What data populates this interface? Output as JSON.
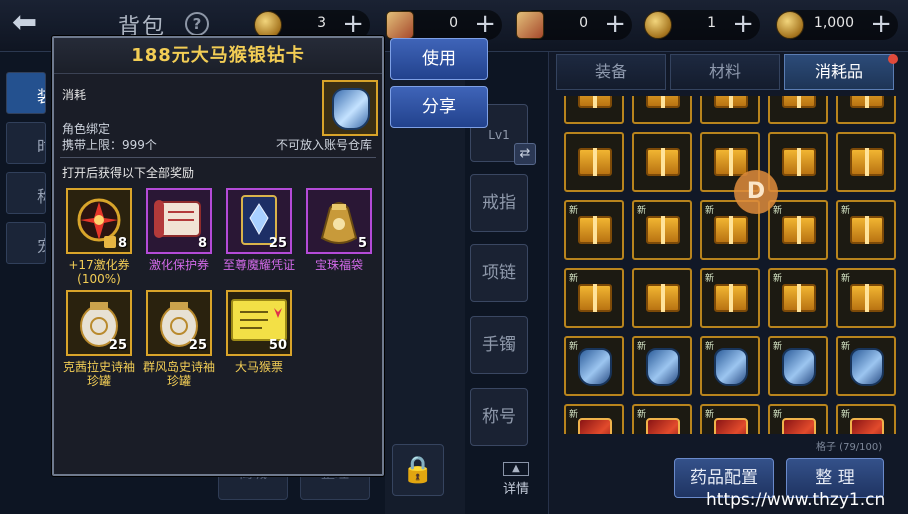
{
  "top_bar": {
    "title": "背包",
    "help_icon": "?",
    "back_icon": "back-arrow-icon",
    "currencies": [
      {
        "icon": "gold-coin-icon",
        "amount": "3"
      },
      {
        "icon": "scroll-icon",
        "amount": "0"
      },
      {
        "icon": "ticket-icon",
        "amount": "0"
      },
      {
        "icon": "gold-coin-icon",
        "amount": "1"
      },
      {
        "icon": "gold-coin-icon",
        "amount": "1,000"
      }
    ],
    "plus_label": "+"
  },
  "popup": {
    "title": "188元大马猴银钻卡",
    "category": "消耗",
    "binding": "角色绑定",
    "carry_limit": "携带上限：999个",
    "storage_note": "不可放入账号仓库",
    "rewards_header": "打开后获得以下全部奖励",
    "rewards": [
      {
        "name": "+17激化券(100%)",
        "count": "8",
        "rarity": "gold",
        "icon": "enhance-ticket-icon",
        "locked": true
      },
      {
        "name": "激化保护券",
        "count": "8",
        "rarity": "purple",
        "icon": "protect-scroll-icon"
      },
      {
        "name": "至尊魔耀凭证",
        "count": "25",
        "rarity": "purple",
        "icon": "card-icon"
      },
      {
        "name": "宝珠福袋",
        "count": "5",
        "rarity": "purple",
        "icon": "lucky-bag-icon"
      },
      {
        "name": "克茜拉史诗袖珍罐",
        "count": "25",
        "rarity": "gold",
        "icon": "jar-icon"
      },
      {
        "name": "群风岛史诗袖珍罐",
        "count": "25",
        "rarity": "gold",
        "icon": "jar-icon"
      },
      {
        "name": "大马猴票",
        "count": "50",
        "rarity": "gold",
        "icon": "ticket-icon"
      }
    ]
  },
  "actions": {
    "use": "使用",
    "share": "分享"
  },
  "left_tabs": [
    "装",
    "时",
    "称",
    "宠"
  ],
  "equip_slots": {
    "weapon_level": "Lv1",
    "slots": [
      "戒指",
      "项链",
      "手镯",
      "称号"
    ]
  },
  "bottom_ghost": [
    "商城",
    "整理"
  ],
  "details_label": "详情",
  "inventory": {
    "tabs": [
      "装备",
      "材料",
      "消耗品"
    ],
    "active_tab": "消耗品",
    "new_badge": "新",
    "capacity": "格子 (79/100)",
    "rows": [
      [
        "gift",
        "gift",
        "gift",
        "gift",
        "gift"
      ],
      [
        "gift",
        "gift",
        "gift",
        "gift",
        "gift"
      ],
      [
        "gift",
        "gift",
        "gift",
        "gift",
        "gift"
      ],
      [
        "gift",
        "gift",
        "gift",
        "gift",
        "gift"
      ],
      [
        "armor",
        "armor",
        "armor",
        "armor",
        "armor"
      ],
      [
        "redbox",
        "redbox",
        "redbox",
        "redbox",
        "redbox"
      ]
    ],
    "new_flags": [
      [
        false,
        false,
        false,
        false,
        false
      ],
      [
        false,
        false,
        false,
        false,
        false
      ],
      [
        true,
        true,
        true,
        true,
        true
      ],
      [
        true,
        false,
        true,
        true,
        true
      ],
      [
        true,
        true,
        true,
        true,
        true
      ],
      [
        true,
        true,
        true,
        true,
        true
      ]
    ],
    "d_badge": "D",
    "medicine_config": "药品配置",
    "sort": "整 理"
  },
  "watermark": "https://www.thzy1.cn"
}
